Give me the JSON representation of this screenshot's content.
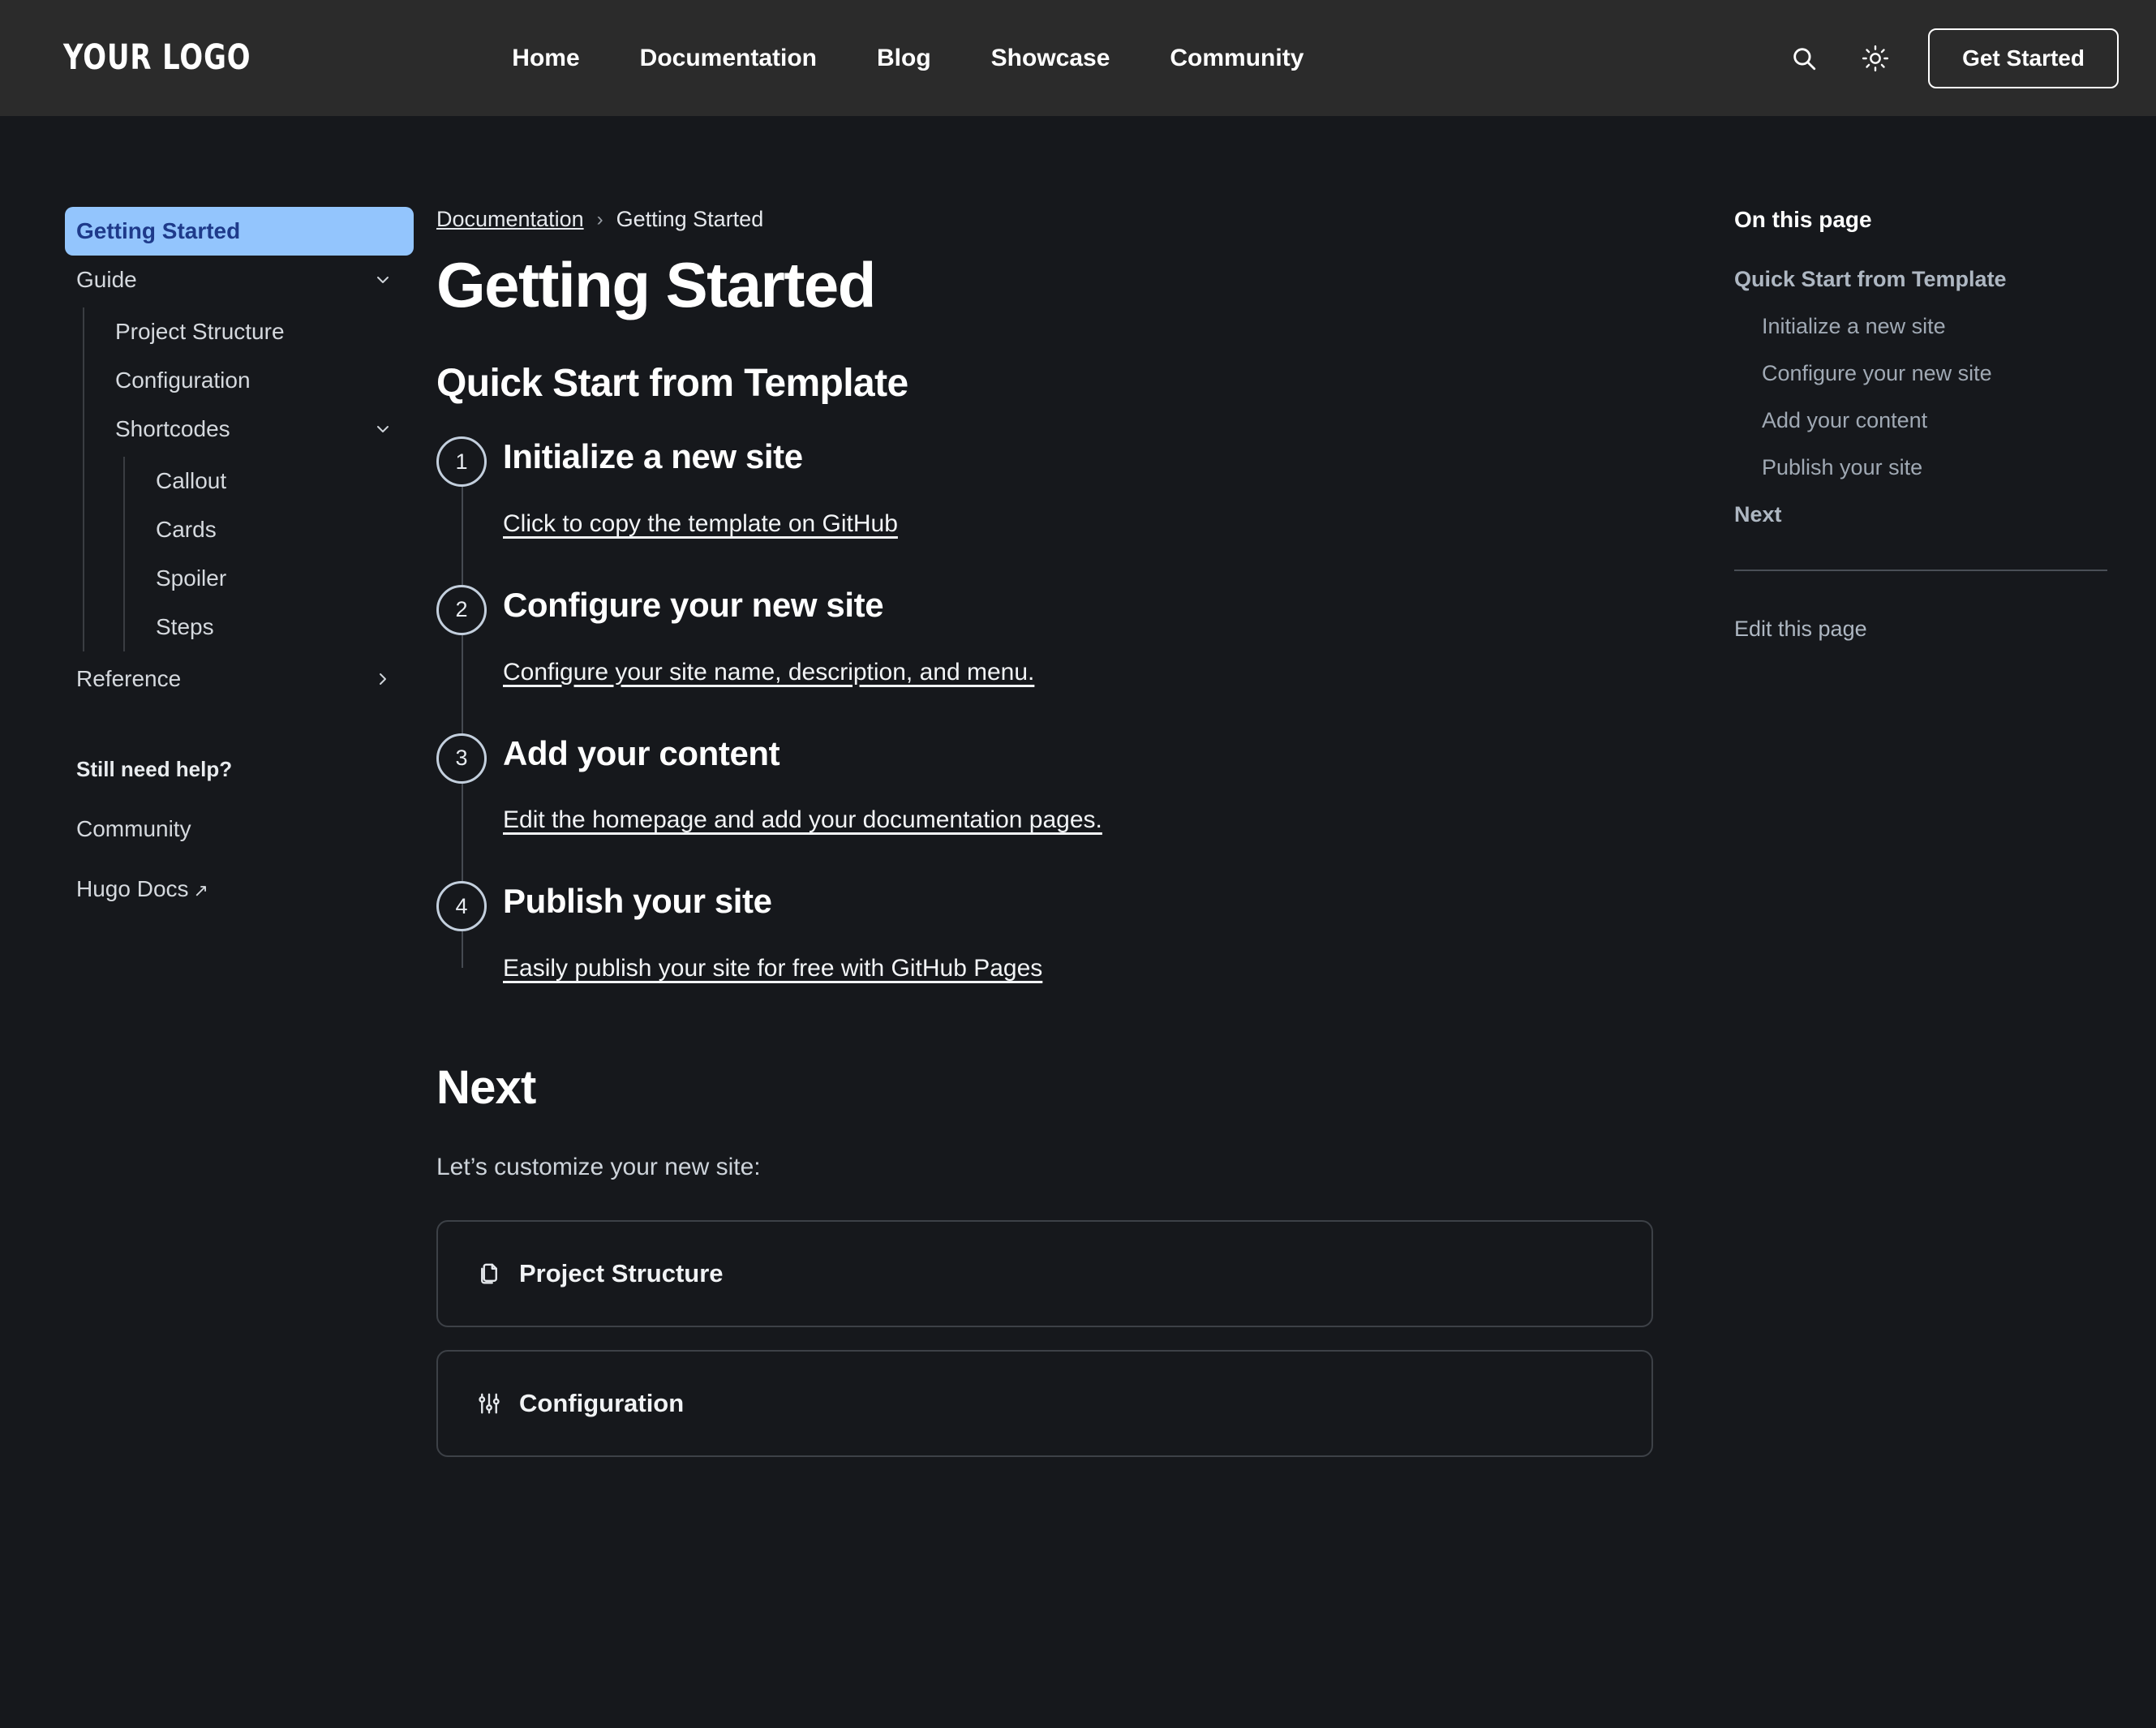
{
  "header": {
    "logo": "Your Logo",
    "nav": [
      {
        "label": "Home"
      },
      {
        "label": "Documentation"
      },
      {
        "label": "Blog"
      },
      {
        "label": "Showcase"
      },
      {
        "label": "Community"
      }
    ],
    "search_icon": "search-icon",
    "theme_icon": "sun-icon",
    "cta_label": "Get Started"
  },
  "sidebar": {
    "items": [
      {
        "label": "Getting Started",
        "active": true
      },
      {
        "label": "Guide",
        "chevron": "down"
      },
      {
        "label": "Project Structure"
      },
      {
        "label": "Configuration"
      },
      {
        "label": "Shortcodes",
        "chevron": "down"
      },
      {
        "label": "Callout"
      },
      {
        "label": "Cards"
      },
      {
        "label": "Spoiler"
      },
      {
        "label": "Steps"
      },
      {
        "label": "Reference",
        "chevron": "right"
      }
    ],
    "help_title": "Still need help?",
    "help_links": [
      {
        "label": "Community",
        "external": false
      },
      {
        "label": "Hugo Docs",
        "external": true,
        "external_glyph": "↗"
      }
    ]
  },
  "breadcrumb": {
    "parent": "Documentation",
    "separator": "›",
    "current": "Getting Started"
  },
  "main": {
    "title": "Getting Started",
    "section_heading": "Quick Start from Template",
    "steps": [
      {
        "number": "1",
        "title": "Initialize a new site",
        "link": "Click to copy the template on GitHub"
      },
      {
        "number": "2",
        "title": "Configure your new site",
        "link": "Configure your site name, description, and menu."
      },
      {
        "number": "3",
        "title": "Add your content",
        "link": "Edit the homepage and add your documentation pages."
      },
      {
        "number": "4",
        "title": "Publish your site",
        "link": "Easily publish your site for free with GitHub Pages"
      }
    ],
    "next_heading": "Next",
    "next_intro": "Let’s customize your new site:",
    "cards": [
      {
        "label": "Project Structure",
        "icon": "copy-files-icon"
      },
      {
        "label": "Configuration",
        "icon": "sliders-icon"
      }
    ]
  },
  "toc": {
    "title": "On this page",
    "items": [
      {
        "label": "Quick Start from Template",
        "level": 2
      },
      {
        "label": "Initialize a new site",
        "level": 3
      },
      {
        "label": "Configure your new site",
        "level": 3
      },
      {
        "label": "Add your content",
        "level": 3
      },
      {
        "label": "Publish your site",
        "level": 3
      },
      {
        "label": "Next",
        "level": 2
      }
    ],
    "edit_label": "Edit this page"
  },
  "colors": {
    "page_bg": "#16181c",
    "header_bg": "#2b2b2b",
    "active_nav_bg": "#93c5fd",
    "active_nav_text": "#1e3a8a",
    "step_circle_border": "#c3cfdd",
    "border": "#3d4147"
  }
}
